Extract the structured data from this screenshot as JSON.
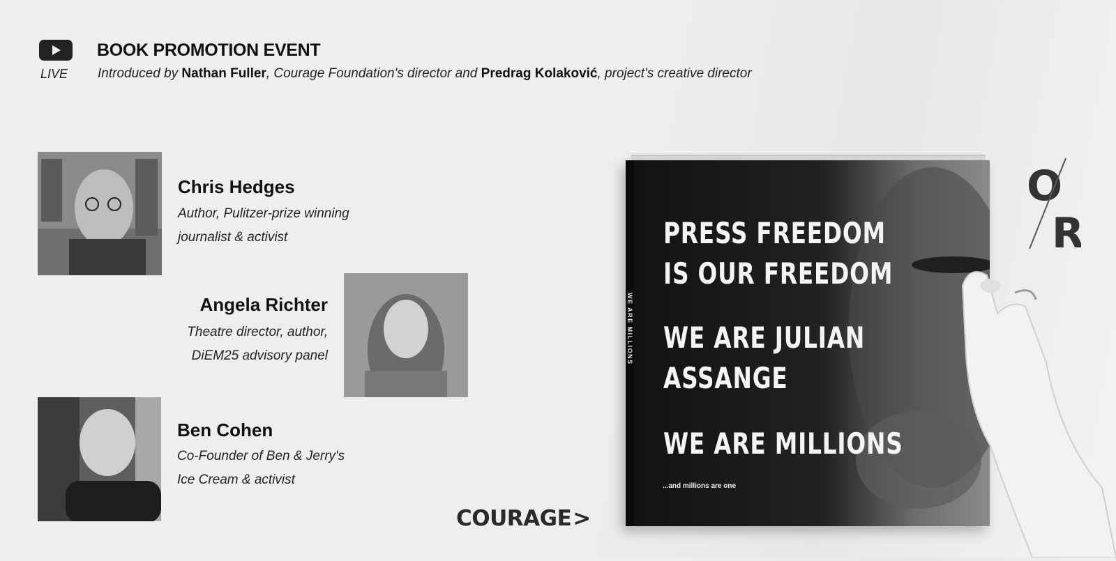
{
  "header": {
    "live_label": "LIVE",
    "title": "BOOK PROMOTION EVENT",
    "intro_prefix": "Introduced by ",
    "host1_name": "Nathan Fuller",
    "host1_role": ", Courage Foundation's director and ",
    "host2_name": "Predrag Kolaković",
    "host2_role": ", project's creative director"
  },
  "speakers": [
    {
      "name": "Chris Hedges",
      "role_line1": "Author, Pulitzer-prize winning",
      "role_line2": "journalist & activist"
    },
    {
      "name": "Angela Richter",
      "role_line1": "Theatre director, author,",
      "role_line2": "DiEM25 advisory panel"
    },
    {
      "name": "Ben Cohen",
      "role_line1": "Co-Founder of Ben & Jerry's",
      "role_line2": "Ice Cream & activist"
    }
  ],
  "logo": {
    "courage": "COURAGE",
    "courage_mark": ">",
    "or_top": "O",
    "or_bottom": "R"
  },
  "book": {
    "spine": "WE ARE MILLIONS",
    "line1": "PRESS FREEDOM",
    "line2": "IS OUR FREEDOM",
    "line3": "WE ARE JULIAN",
    "line4": "ASSANGE",
    "line5": "WE ARE MILLIONS",
    "tagline": "...and millions are one"
  },
  "icons": {
    "live": "youtube-play-icon"
  },
  "colors": {
    "background": "#efefef",
    "text": "#111111",
    "book_cover": "#111111"
  }
}
